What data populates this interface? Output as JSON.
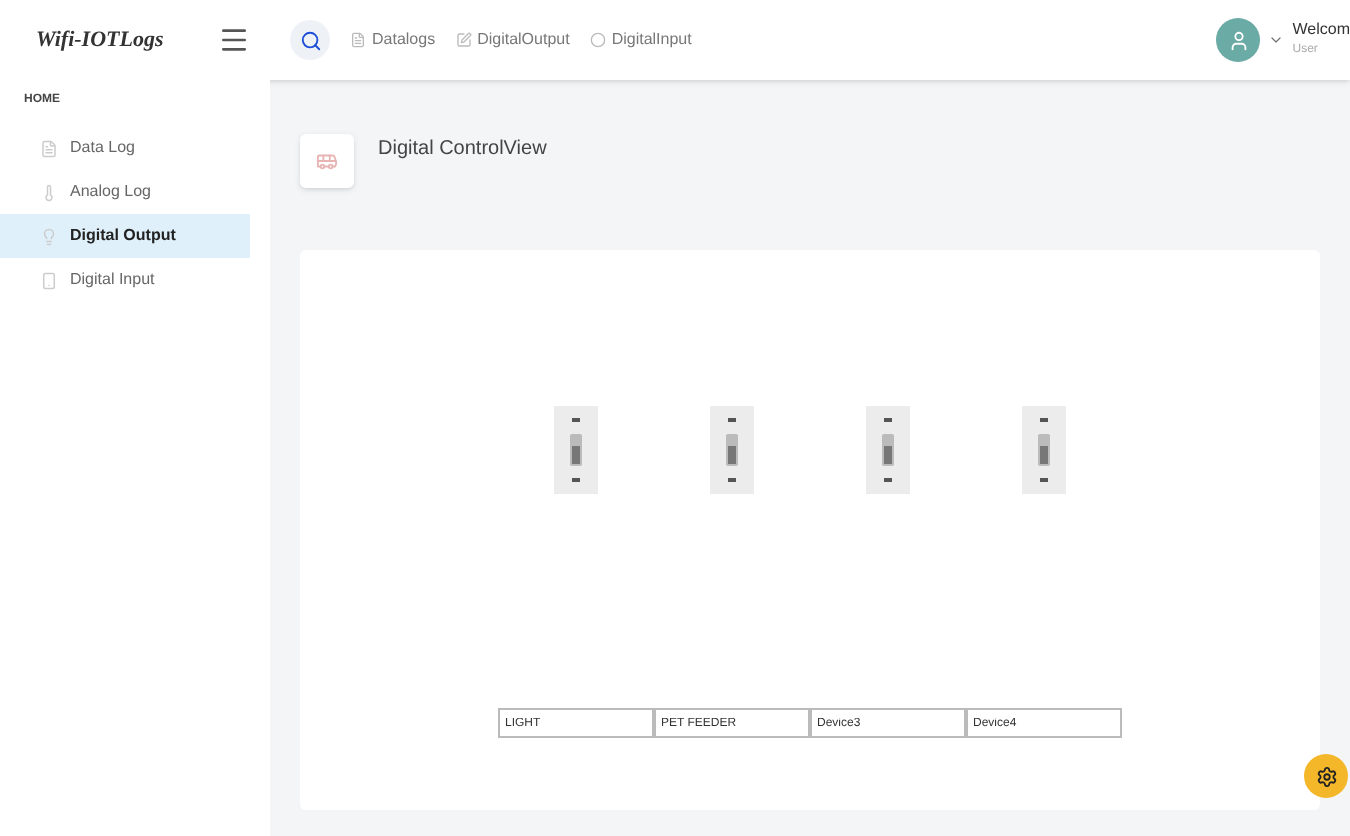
{
  "brand": "Wifi-IOTLogs",
  "topnav": [
    {
      "label": "Datalogs"
    },
    {
      "label": "DigitalOutput"
    },
    {
      "label": "DigitalInput"
    }
  ],
  "user": {
    "greeting": "Welcom",
    "name": "User"
  },
  "sidebar": {
    "heading": "HOME",
    "items": [
      {
        "label": "Data Log",
        "selected": false
      },
      {
        "label": "Analog Log",
        "selected": false
      },
      {
        "label": "Digital Output",
        "selected": true
      },
      {
        "label": "Digital Input",
        "selected": false
      }
    ]
  },
  "page_title": "Digital ControlView",
  "devices": [
    {
      "name": "LIGHT"
    },
    {
      "name": "PET FEEDER"
    },
    {
      "name": "Device3"
    },
    {
      "name": "Device4"
    }
  ]
}
